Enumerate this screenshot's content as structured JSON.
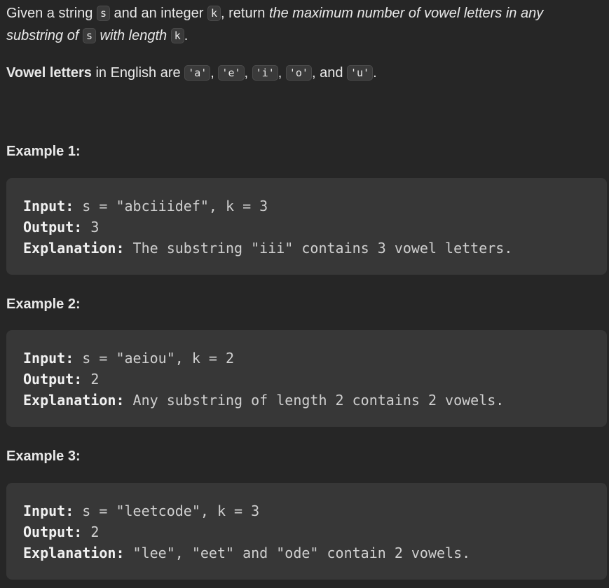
{
  "description": {
    "l1_a": "Given a string ",
    "code_s": "s",
    "l1_b": " and an integer ",
    "code_k": "k",
    "l1_c": ", return ",
    "l1_italic": "the maximum number of vowel letters in any",
    "l2_italic_a": "substring of ",
    "l2_italic_b": " with length ",
    "l2_end": "."
  },
  "vowels_line": {
    "bold": "Vowel letters",
    "text": " in English are ",
    "v1": "'a'",
    "sep1": ", ",
    "v2": "'e'",
    "sep2": ", ",
    "v3": "'i'",
    "sep3": ", ",
    "v4": "'o'",
    "sep4": ", and ",
    "v5": "'u'",
    "end": "."
  },
  "examples": [
    {
      "title": "Example 1:",
      "input_label": "Input:",
      "input_value": " s = \"abciiidef\", k = 3",
      "output_label": "Output:",
      "output_value": " 3",
      "explanation_label": "Explanation:",
      "explanation_value": " The substring \"iii\" contains 3 vowel letters."
    },
    {
      "title": "Example 2:",
      "input_label": "Input:",
      "input_value": " s = \"aeiou\", k = 2",
      "output_label": "Output:",
      "output_value": " 2",
      "explanation_label": "Explanation:",
      "explanation_value": " Any substring of length 2 contains 2 vowels."
    },
    {
      "title": "Example 3:",
      "input_label": "Input:",
      "input_value": " s = \"leetcode\", k = 3",
      "output_label": "Output:",
      "output_value": " 2",
      "explanation_label": "Explanation:",
      "explanation_value": " \"lee\", \"eet\" and \"ode\" contain 2 vowels."
    }
  ]
}
